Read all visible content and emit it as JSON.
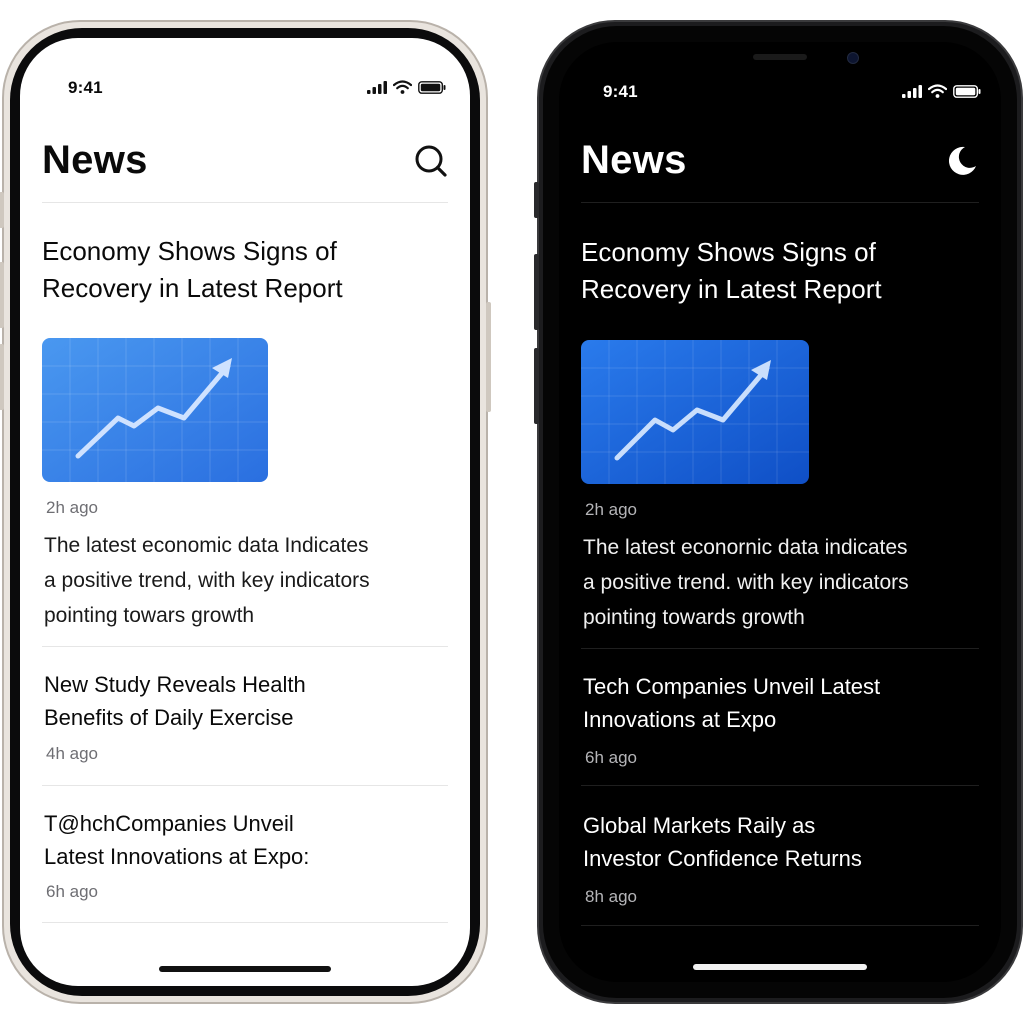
{
  "light": {
    "status": {
      "time": "9:41"
    },
    "header": {
      "title": "News",
      "action_icon": "search-icon"
    },
    "featured": {
      "headline_line1": "Economy Shows Signs of",
      "headline_line2": "Recovery in Latest Report",
      "image_icon": "trend-chart-icon",
      "time_ago": "2h ago",
      "desc_line1": "The latest economic data Indicates",
      "desc_line2": "a positive trend, with key indicators",
      "desc_line3": "pointing towars growth"
    },
    "items": [
      {
        "title_line1": "New Study Reveals Health",
        "title_line2": "Benefits of Daily Exercise",
        "time_ago": "4h ago"
      },
      {
        "title_line1": "T@hchCompanies Unveil",
        "title_line2": "Latest Innovations at Expo:",
        "time_ago": "6h ago"
      }
    ]
  },
  "dark": {
    "status": {
      "time": "9:41"
    },
    "header": {
      "title": "News",
      "action_icon": "moon-icon"
    },
    "featured": {
      "headline_line1": "Economy Shows Signs of",
      "headline_line2": "Recovery in Latest Report",
      "image_icon": "trend-chart-icon",
      "time_ago": "2h ago",
      "desc_line1": "The latest econornic data indicates",
      "desc_line2": "a positive trend. with key indicators",
      "desc_line3": "pointing towards growth"
    },
    "items": [
      {
        "title_line1": "Tech Companies Unveil Latest",
        "title_line2": "Innovations at Expo",
        "time_ago": "6h ago"
      },
      {
        "title_line1": "Global Markets Raily as",
        "title_line2": "Investor Confidence Returns",
        "time_ago": "8h ago"
      }
    ]
  },
  "colors": {
    "chart_tile_light": "#3a86e8",
    "chart_tile_dark": "#1d63d8",
    "light_bg": "#ffffff",
    "dark_bg": "#000000"
  }
}
